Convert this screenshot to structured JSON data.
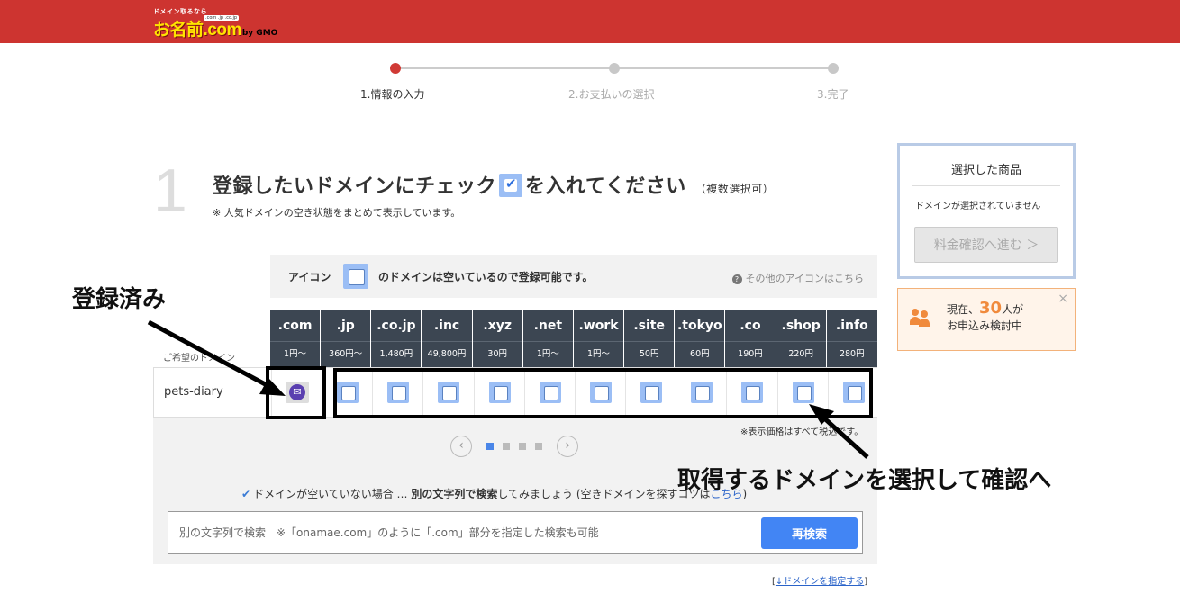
{
  "brand": {
    "tagline": "ドメイン取るなら",
    "logo_text": "お名前.com",
    "logo_sub": ".com .jp .co.jp",
    "logo_gmo": "by GMO"
  },
  "steps": [
    {
      "label": "1.情報の入力",
      "active": true
    },
    {
      "label": "2.お支払いの選択",
      "active": false
    },
    {
      "label": "3.完了",
      "active": false
    }
  ],
  "section": {
    "number": "1",
    "title_before": "登録したいドメインにチェック",
    "title_after": "を入れてください",
    "multi_note": "（複数選択可）",
    "subnote": "※ 人気ドメインの空き状態をまとめて表示しています。"
  },
  "icon_legend": {
    "prefix": "アイコン",
    "text": "のドメインは空いているので登録可能です。",
    "help_link": "その他のアイコンはこちら"
  },
  "desired_label": "ご希望のドメイン",
  "tlds": [
    {
      "tld": ".com",
      "price": "1円〜"
    },
    {
      "tld": ".jp",
      "price": "360円〜"
    },
    {
      "tld": ".co.jp",
      "price": "1,480円"
    },
    {
      "tld": ".inc",
      "price": "49,800円"
    },
    {
      "tld": ".xyz",
      "price": "30円"
    },
    {
      "tld": ".net",
      "price": "1円〜"
    },
    {
      "tld": ".work",
      "price": "1円〜"
    },
    {
      "tld": ".site",
      "price": "50円"
    },
    {
      "tld": ".tokyo",
      "price": "60円"
    },
    {
      "tld": ".co",
      "price": "190円"
    },
    {
      "tld": ".shop",
      "price": "220円"
    },
    {
      "tld": ".info",
      "price": "280円"
    }
  ],
  "domain_row": {
    "name": "pets-diary",
    "status": [
      "registered",
      "available",
      "available",
      "available",
      "available",
      "available",
      "available",
      "available",
      "available",
      "available",
      "available",
      "available"
    ]
  },
  "tax_note": "※表示価格はすべて税込です。",
  "pager": {
    "pages": 4,
    "current": 1,
    "prev": "‹",
    "next": "›"
  },
  "hint": {
    "check": "✔",
    "before": "ドメインが空いていない場合 … ",
    "bold": "別の文字列で検索",
    "after": "してみましょう (空きドメインを探すコツは",
    "link": "こちら",
    "close": ")"
  },
  "search": {
    "placeholder": "別の文字列で検索　※「onamae.com」のように「.com」部分を指定した検索も可能",
    "button": "再検索"
  },
  "specify_link": {
    "open": "[",
    "text": "↓ドメインを指定する",
    "close": "]"
  },
  "cart": {
    "title": "選択した商品",
    "empty": "ドメインが選択されていません",
    "button": "料金確認へ進む ＞"
  },
  "live": {
    "prefix": "現在、",
    "count": "30",
    "suffix": "人が",
    "line2": "お申込み検討中",
    "close": "×"
  },
  "annotations": {
    "left": "登録済み",
    "right": "取得するドメインを選択して確認へ"
  },
  "colors": {
    "header": "#cd3430",
    "accent": "#4285f4",
    "tld_header": "#3c4652",
    "checkbox": "#9bbef5",
    "step_active": "#d03a35"
  }
}
